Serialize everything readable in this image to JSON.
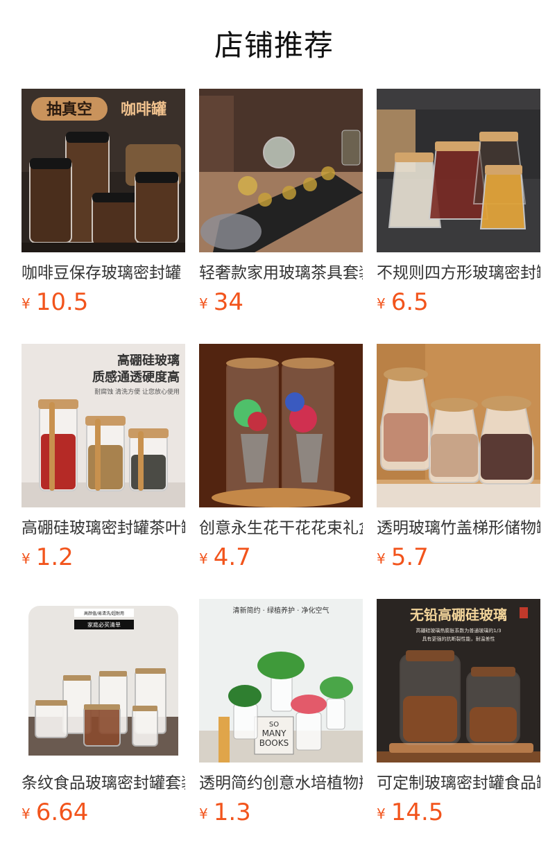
{
  "page": {
    "title": "店铺推荐"
  },
  "colors": {
    "price": "#f2541c",
    "title": "#111111"
  },
  "products": [
    {
      "name": "咖啡豆保存玻璃密封罐",
      "currency": "¥",
      "price": "10.5",
      "image": {
        "icon": "coffee-jar-image",
        "overlay_badge": "抽真空",
        "overlay_text": "咖啡罐"
      }
    },
    {
      "name": "轻奢款家用玻璃茶具套装",
      "currency": "¥",
      "price": "34",
      "image": {
        "icon": "tea-set-image"
      }
    },
    {
      "name": "不规则四方形玻璃密封罐",
      "currency": "¥",
      "price": "6.5",
      "image": {
        "icon": "square-jars-image"
      }
    },
    {
      "name": "高硼硅玻璃密封罐茶叶罐",
      "currency": "¥",
      "price": "1.2",
      "image": {
        "icon": "spice-jars-image",
        "line1": "高硼硅玻璃",
        "line2": "质感通透硬度高",
        "line3": "耐腐蚀 清洗方便 让您放心使用"
      }
    },
    {
      "name": "创意永生花干花花束礼盒",
      "currency": "¥",
      "price": "4.7",
      "image": {
        "icon": "preserved-flower-image"
      }
    },
    {
      "name": "透明玻璃竹盖梯形储物罐",
      "currency": "¥",
      "price": "5.7",
      "image": {
        "icon": "nut-jars-image"
      }
    },
    {
      "name": "条纹食品玻璃密封罐套装",
      "currency": "¥",
      "price": "6.64",
      "image": {
        "icon": "striped-jars-image",
        "tag1": "高颜值/易清洗/超耐用",
        "tag2": "家庭必买清单"
      }
    },
    {
      "name": "透明简约创意水培植物瓶",
      "currency": "¥",
      "price": "1.3",
      "image": {
        "icon": "hydroponic-plant-image",
        "line1": "清新简约 · 绿植养护 · 净化空气",
        "book1": "SO",
        "book2": "MANY",
        "book3": "BOOKS"
      }
    },
    {
      "name": "可定制玻璃密封罐食品罐",
      "currency": "¥",
      "price": "14.5",
      "image": {
        "icon": "lead-free-jars-image",
        "line1": "无铅高硼硅玻璃",
        "line2": "高硼硅玻璃热膨胀系数为普通玻璃的1/3",
        "line3": "具有更强的抗断裂性能，耐温差性"
      }
    }
  ]
}
